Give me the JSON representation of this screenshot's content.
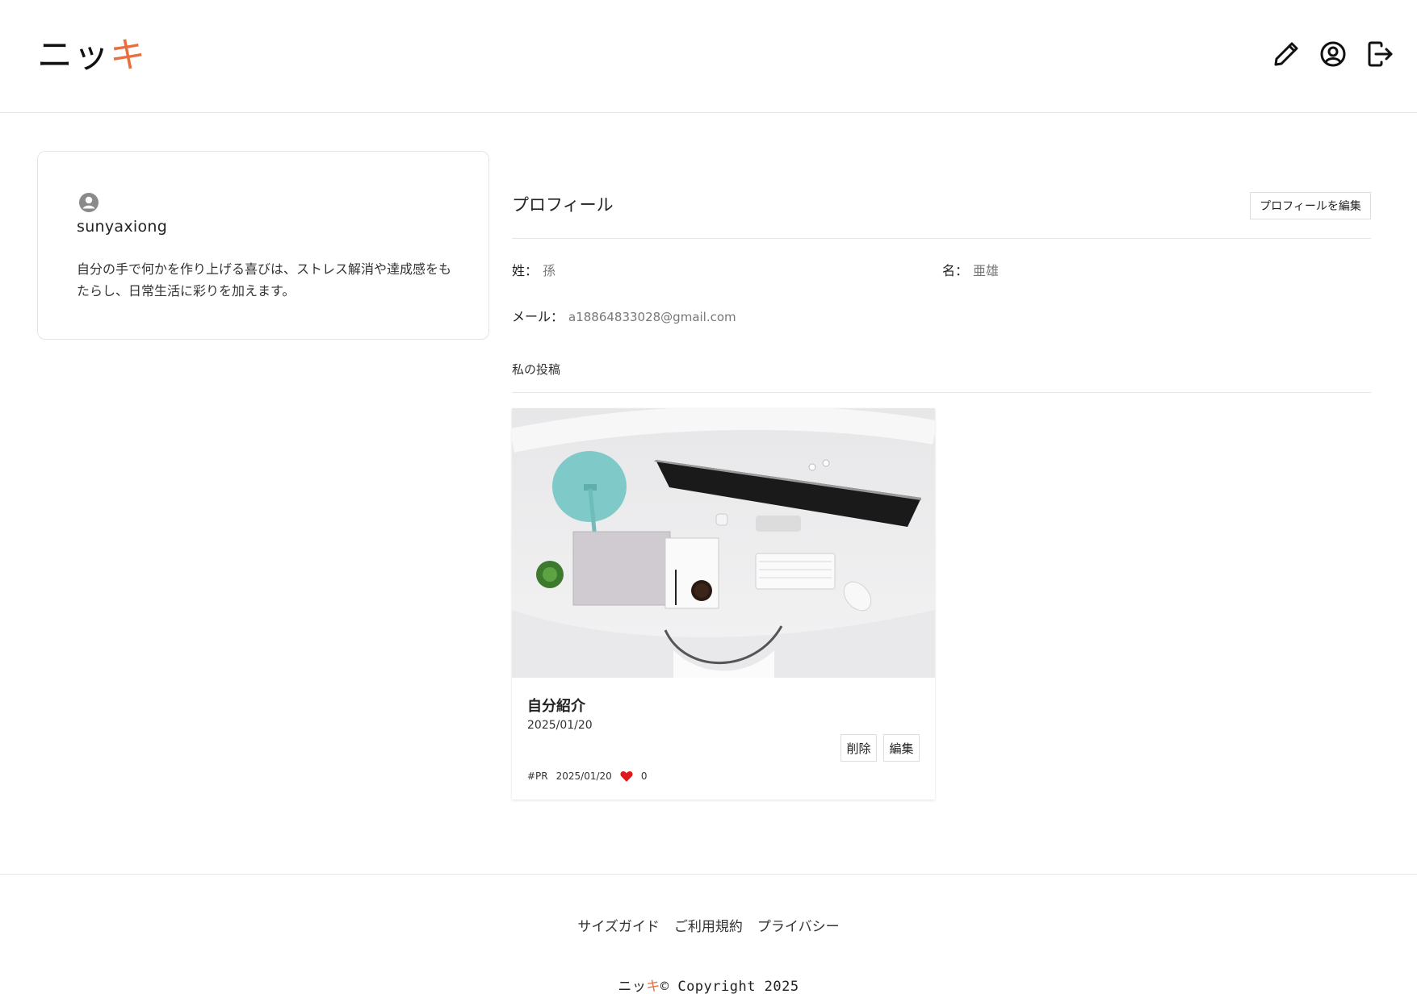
{
  "header": {
    "logo_part1": "ニッ",
    "logo_part2": "キ",
    "icons": [
      "pencil-icon",
      "user-circle-icon",
      "logout-icon"
    ]
  },
  "profile_card": {
    "username": "sunyaxiong",
    "bio": "自分の手で何かを作り上げる喜びは、ストレス解消や達成感をもたらし、日常生活に彩りを加えます。"
  },
  "profile": {
    "title": "プロフィール",
    "edit_button": "プロフィールを編集",
    "last_name_label": "姓：",
    "last_name": "孫",
    "first_name_label": "名：",
    "first_name": "亜雄",
    "email_label": "メール：",
    "email": "a18864833028@gmail.com"
  },
  "posts": {
    "title": "私の投稿",
    "items": [
      {
        "title": "自分紹介",
        "date": "2025/01/20",
        "delete_label": "削除",
        "edit_label": "編集",
        "tag": "#PR",
        "meta_date": "2025/01/20",
        "likes": "0"
      }
    ]
  },
  "footer": {
    "links": [
      "サイズガイド",
      "ご利用規約",
      "プライバシー"
    ],
    "copy_logo1": "ニッ",
    "copy_logo2": "キ",
    "copyright": "© Copyright 2025"
  },
  "colors": {
    "accent": "#e8703f",
    "heart": "#e0191c"
  }
}
